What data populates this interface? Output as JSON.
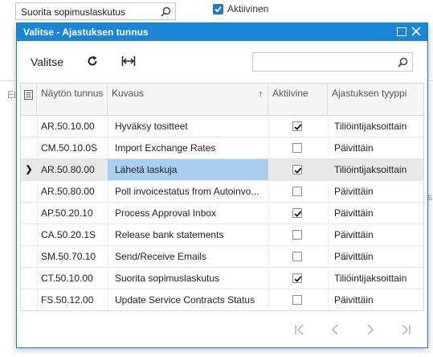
{
  "background": {
    "search_value": "Suorita sopimuslaskutus",
    "active_label": "Aktiivinen",
    "left_fragment": "El",
    "right_fragment": "s"
  },
  "dialog": {
    "title": "Valitse - Ajastuksen tunnus",
    "toolbar": {
      "select_label": "Valitse",
      "search_placeholder": ""
    },
    "columns": {
      "id": "Näytön tunnus",
      "desc": "Kuvaus",
      "active": "Aktiivine",
      "type": "Ajastuksen tyyppi"
    },
    "rows": [
      {
        "id": "AR.50.10.00",
        "desc": "Hyväksy tositteet",
        "active": true,
        "type": "Tiliöintijaksoittain",
        "current": false
      },
      {
        "id": "CM.50.10.0S",
        "desc": "Import Exchange Rates",
        "active": false,
        "type": "Päivittäin",
        "current": false
      },
      {
        "id": "AR.50.80.00",
        "desc": "Lähetä laskuja",
        "active": true,
        "type": "Tiliöintijaksoittain",
        "current": true
      },
      {
        "id": "AR.50.80.00",
        "desc": "Poll invoicestatus from Autoinvo...",
        "active": false,
        "type": "Päivittäin",
        "current": false
      },
      {
        "id": "AP.50.20.10",
        "desc": "Process Approval Inbox",
        "active": true,
        "type": "Päivittäin",
        "current": false
      },
      {
        "id": "CA.50.20.1S",
        "desc": "Release bank statements",
        "active": false,
        "type": "Päivittäin",
        "current": false
      },
      {
        "id": "SM.50.70.10",
        "desc": "Send/Receive Emails",
        "active": false,
        "type": "Päivittäin",
        "current": false
      },
      {
        "id": "CT.50.10.00",
        "desc": "Suorita sopimuslaskutus",
        "active": true,
        "type": "Tiliöintijaksoittain",
        "current": false
      },
      {
        "id": "FS.50.12.00",
        "desc": "Update Service Contracts Status",
        "active": false,
        "type": "Päivittäin",
        "current": false
      }
    ],
    "pager": [
      "first-page-icon",
      "prev-page-icon",
      "next-page-icon",
      "last-page-icon"
    ]
  },
  "colors": {
    "accent": "#1a86d6",
    "selected_cell": "#a9cff0",
    "checkbox_bg": "#1f77cf"
  }
}
